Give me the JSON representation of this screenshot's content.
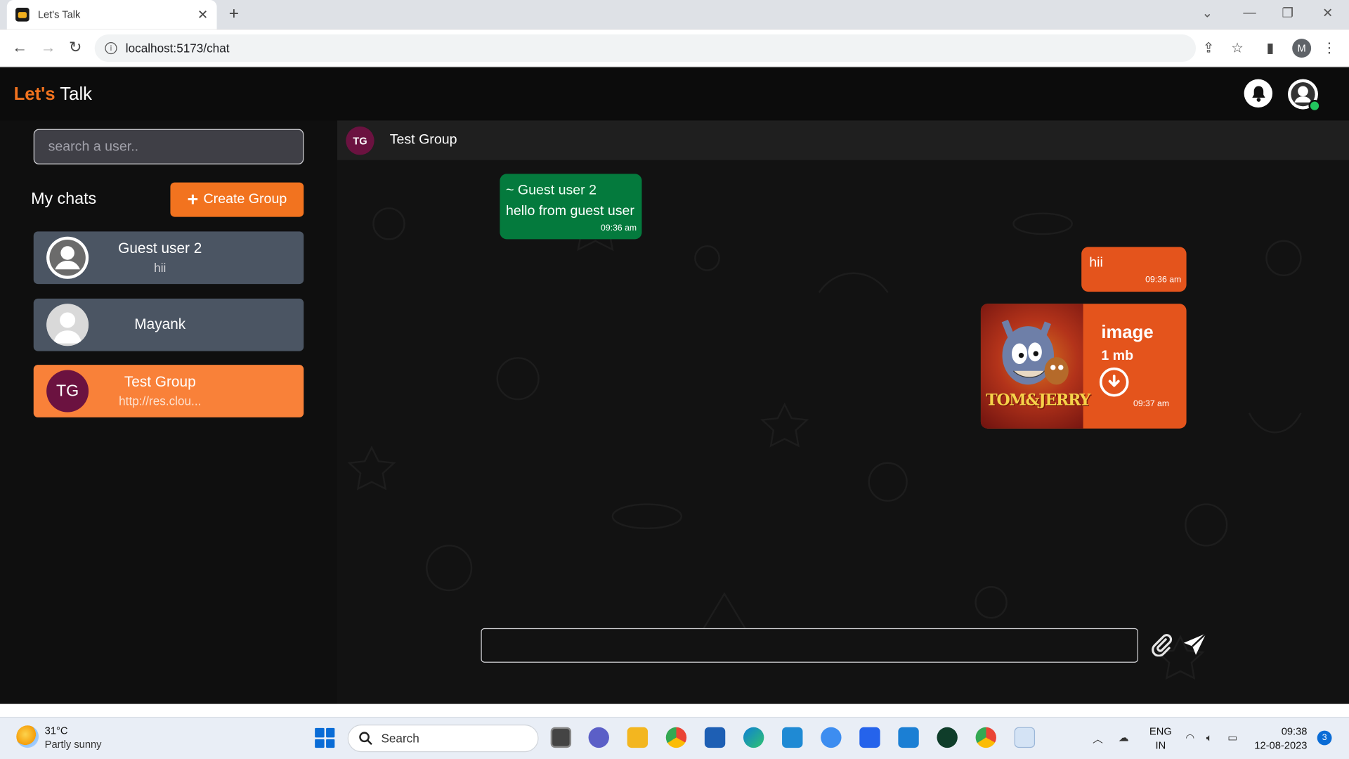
{
  "browser": {
    "tab_title": "Let's Talk",
    "tab_close": "✕",
    "new_tab": "+",
    "url": "localhost:5173/chat",
    "profile_initial": "M"
  },
  "app": {
    "brand_accent": "Let's",
    "brand_rest": "Talk",
    "accent_color": "#f2731f"
  },
  "sidebar": {
    "search_placeholder": "search a user..",
    "my_chats_label": "My chats",
    "create_group_label": "Create Group",
    "chats": [
      {
        "name": "Guest user 2",
        "last_message": "hii",
        "avatar": "default-user-icon"
      },
      {
        "name": "Mayank",
        "last_message": "",
        "avatar": "person-silhouette-icon"
      },
      {
        "name": "Test Group",
        "last_message": "http://res.clou...",
        "initials": "TG",
        "active": true
      }
    ]
  },
  "chat": {
    "header_initials": "TG",
    "header_title": "Test Group",
    "messages": [
      {
        "direction": "received",
        "sender": "~ Guest user 2",
        "text": "hello from guest user",
        "time": "09:36 am",
        "color": "#047a3d"
      },
      {
        "direction": "sent",
        "text": "hii",
        "time": "09:36 am",
        "color": "#e4541c"
      },
      {
        "direction": "sent",
        "type": "image",
        "label": "image",
        "size": "1 mb",
        "time": "09:37 am",
        "thumb_text": "TOM&JERRY"
      }
    ],
    "input_value": ""
  },
  "taskbar": {
    "temperature": "31°C",
    "condition": "Partly sunny",
    "search_label": "Search",
    "lang_line1": "ENG",
    "lang_line2": "IN",
    "time": "09:38",
    "date": "12-08-2023",
    "notification_count": "3"
  }
}
